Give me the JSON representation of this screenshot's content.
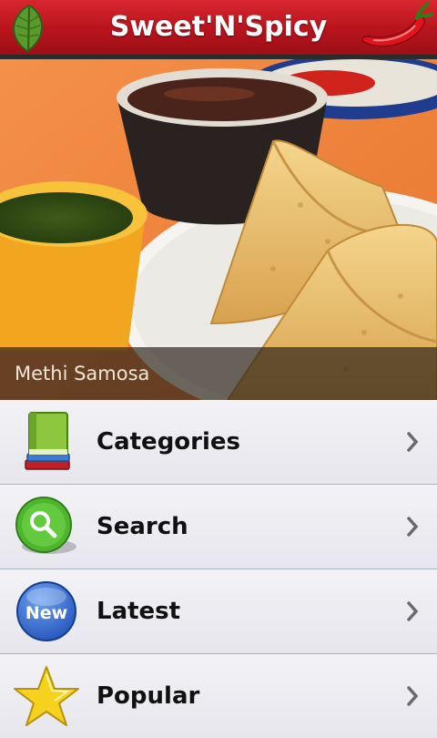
{
  "header": {
    "title": "Sweet'N'Spicy"
  },
  "hero": {
    "caption": "Methi Samosa"
  },
  "menu": {
    "items": [
      {
        "label": "Categories",
        "icon": "books-icon"
      },
      {
        "label": "Search",
        "icon": "magnifier-icon"
      },
      {
        "label": "Latest",
        "icon": "new-badge-icon",
        "badge": "New"
      },
      {
        "label": "Popular",
        "icon": "star-icon"
      }
    ]
  },
  "colors": {
    "header": "#c81b24",
    "row_bg": "#ecebf0",
    "divider": "#a9b2bd"
  }
}
